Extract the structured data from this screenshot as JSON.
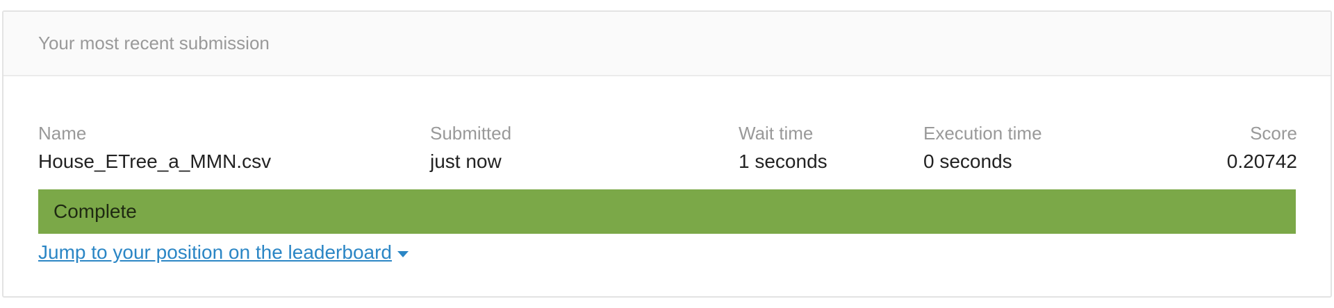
{
  "card": {
    "title": "Your most recent submission"
  },
  "submission": {
    "columns": {
      "name_label": "Name",
      "submitted_label": "Submitted",
      "wait_label": "Wait time",
      "exec_label": "Execution time",
      "score_label": "Score"
    },
    "values": {
      "name": "House_ETree_a_MMN.csv",
      "submitted": "just now",
      "wait": "1 seconds",
      "exec": "0 seconds",
      "score": "0.20742"
    },
    "status": {
      "text": "Complete",
      "color": "#7ba848"
    }
  },
  "link": {
    "text": "Jump to your position on the leaderboard",
    "icon": "caret-down-icon",
    "color": "#2b86c5"
  }
}
